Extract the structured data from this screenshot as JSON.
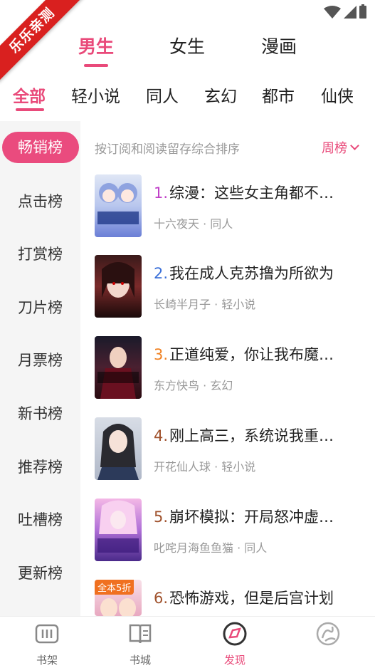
{
  "watermark": "乐乐亲测",
  "gender_tabs": [
    {
      "label": "男生",
      "active": true
    },
    {
      "label": "女生",
      "active": false
    },
    {
      "label": "漫画",
      "active": false
    }
  ],
  "category_tabs": [
    {
      "label": "全部",
      "active": true
    },
    {
      "label": "轻小说",
      "active": false
    },
    {
      "label": "同人",
      "active": false
    },
    {
      "label": "玄幻",
      "active": false
    },
    {
      "label": "都市",
      "active": false
    },
    {
      "label": "仙侠",
      "active": false
    }
  ],
  "sidebar": {
    "items": [
      {
        "label": "畅销榜",
        "active": true
      },
      {
        "label": "点击榜",
        "active": false
      },
      {
        "label": "打赏榜",
        "active": false
      },
      {
        "label": "刀片榜",
        "active": false
      },
      {
        "label": "月票榜",
        "active": false
      },
      {
        "label": "新书榜",
        "active": false
      },
      {
        "label": "推荐榜",
        "active": false
      },
      {
        "label": "吐槽榜",
        "active": false
      },
      {
        "label": "更新榜",
        "active": false
      }
    ]
  },
  "ranking": {
    "description": "按订阅和阅读留存综合排序",
    "period": "周榜",
    "books": [
      {
        "rank": "1.",
        "title": "综漫：这些女主角都不…",
        "author": "十六夜天",
        "genre": "同人",
        "rank_color": "#c040c8"
      },
      {
        "rank": "2.",
        "title": "我在成人克苏撸为所欲为",
        "author": "长崎半月子",
        "genre": "轻小说",
        "rank_color": "#3a6fd8"
      },
      {
        "rank": "3.",
        "title": "正道纯爱，你让我布魔…",
        "author": "东方快鸟",
        "genre": "玄幻",
        "rank_color": "#f08020"
      },
      {
        "rank": "4.",
        "title": "刚上高三，系统说我重…",
        "author": "开花仙人球",
        "genre": "轻小说",
        "rank_color": "#a0522d"
      },
      {
        "rank": "5.",
        "title": "崩坏模拟：开局怒冲虚…",
        "author": "叱咤月海鱼鱼猫",
        "genre": "同人",
        "rank_color": "#a0522d"
      },
      {
        "rank": "6.",
        "title": "恐怖游戏，但是后宫计划",
        "author": "",
        "genre": "",
        "rank_color": "#a0522d",
        "badge": "全本5折"
      }
    ]
  },
  "bottom_nav": [
    {
      "label": "书架",
      "icon": "bookshelf-icon",
      "active": false
    },
    {
      "label": "书城",
      "icon": "book-store-icon",
      "active": false
    },
    {
      "label": "发现",
      "icon": "compass-icon",
      "active": true
    },
    {
      "label": "",
      "icon": "profile-logo-icon",
      "active": false
    }
  ],
  "colors": {
    "accent": "#e94a7a",
    "sidebar_bg": "#f5f5f5"
  }
}
